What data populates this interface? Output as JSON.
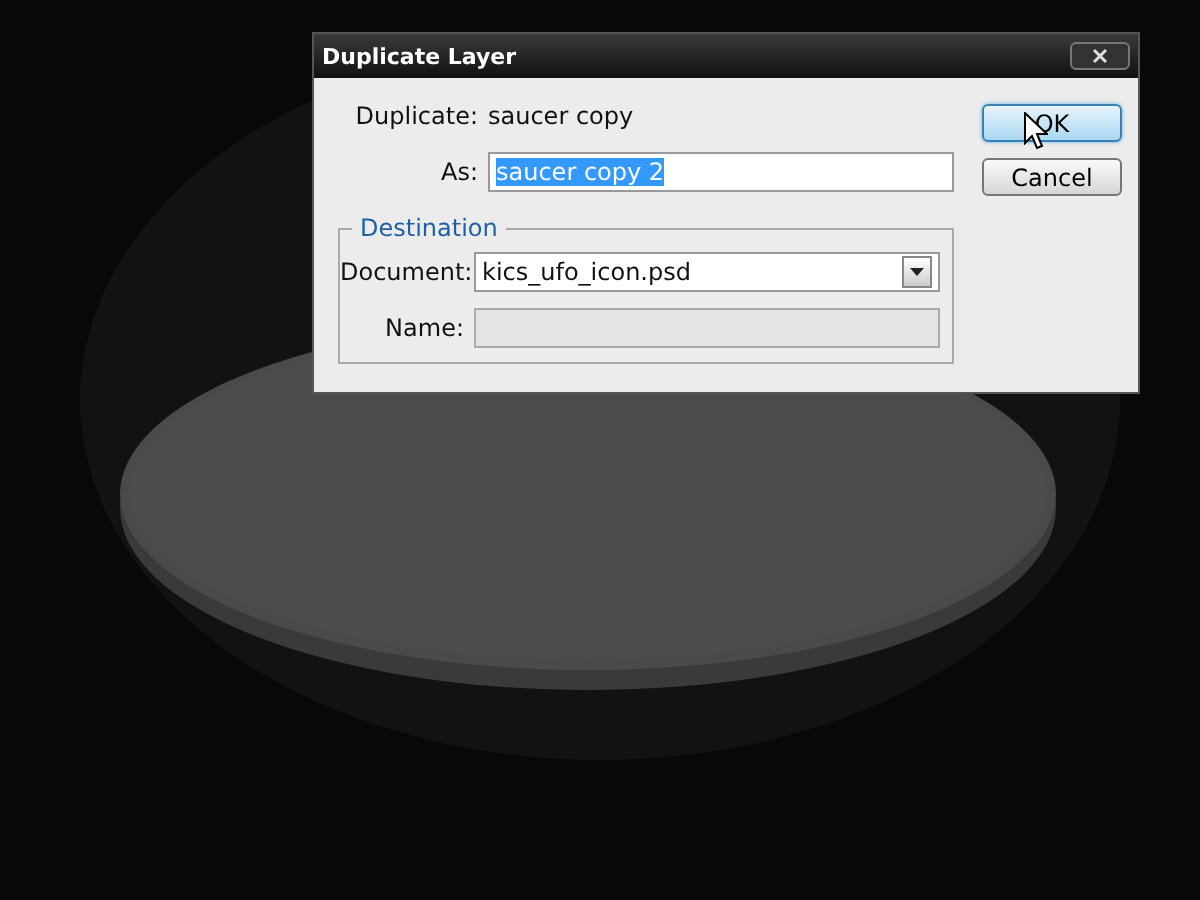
{
  "dialog": {
    "title": "Duplicate Layer",
    "duplicate": {
      "label": "Duplicate:",
      "value": "saucer copy"
    },
    "as_field": {
      "label": "As:",
      "value": "saucer copy 2",
      "text_selected": true
    },
    "destination": {
      "legend": "Destination",
      "document": {
        "label": "Document:",
        "value": "kics_ufo_icon.psd"
      },
      "name_field": {
        "label": "Name:",
        "disabled": true
      }
    },
    "buttons": [
      {
        "label": "OK",
        "default": true
      },
      {
        "label": "Cancel",
        "default": false
      }
    ]
  }
}
